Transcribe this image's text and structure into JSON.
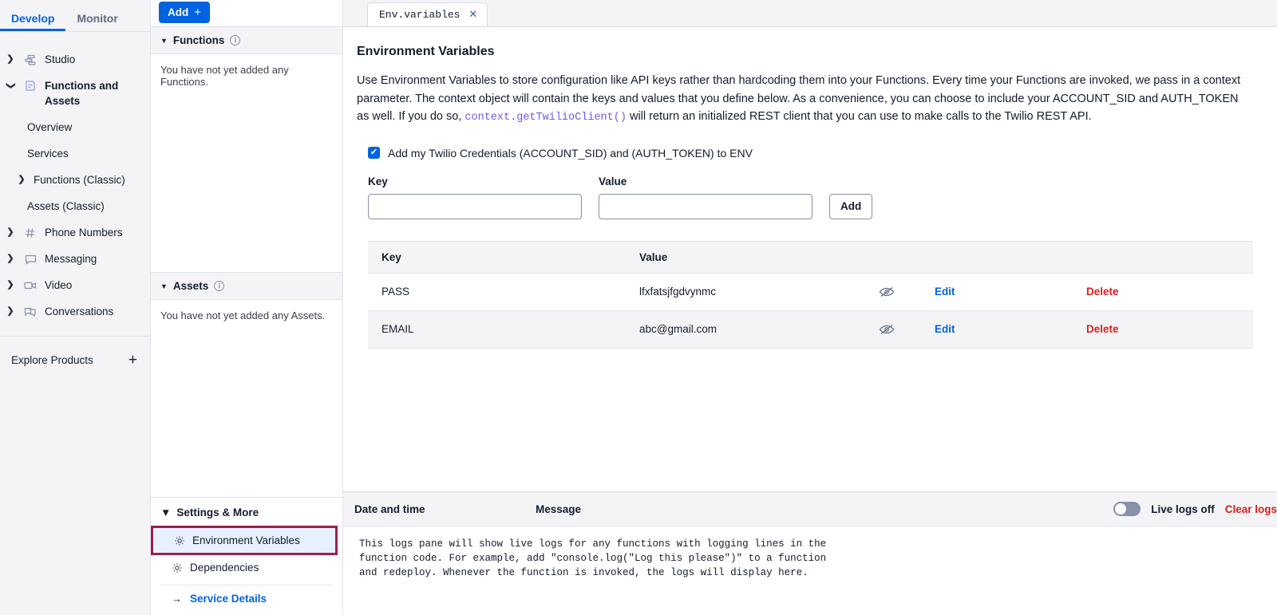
{
  "nav": {
    "tabs": [
      {
        "label": "Develop",
        "active": true
      },
      {
        "label": "Monitor",
        "active": false
      }
    ],
    "items": [
      {
        "label": "Studio",
        "icon": "studio-icon",
        "chevron": "right",
        "bold": false,
        "indent": 0
      },
      {
        "label": "Functions and Assets",
        "icon": "functions-icon",
        "chevron": "down",
        "bold": true,
        "indent": 0
      },
      {
        "label": "Overview",
        "icon": "",
        "chevron": "",
        "bold": false,
        "indent": 2
      },
      {
        "label": "Services",
        "icon": "",
        "chevron": "",
        "bold": false,
        "indent": 2
      },
      {
        "label": "Functions (Classic)",
        "icon": "",
        "chevron": "right",
        "bold": false,
        "indent": 1
      },
      {
        "label": "Assets (Classic)",
        "icon": "",
        "chevron": "",
        "bold": false,
        "indent": 2
      },
      {
        "label": "Phone Numbers",
        "icon": "hash-icon",
        "chevron": "right",
        "bold": false,
        "indent": 0
      },
      {
        "label": "Messaging",
        "icon": "chat-icon",
        "chevron": "right",
        "bold": false,
        "indent": 0
      },
      {
        "label": "Video",
        "icon": "video-icon",
        "chevron": "right",
        "bold": false,
        "indent": 0
      },
      {
        "label": "Conversations",
        "icon": "conversations-icon",
        "chevron": "right",
        "bold": false,
        "indent": 0
      }
    ],
    "explore_label": "Explore Products"
  },
  "midpanel": {
    "add_button": "Add",
    "functions_section": {
      "title": "Functions",
      "empty_text": "You have not yet added any Functions."
    },
    "assets_section": {
      "title": "Assets",
      "empty_text": "You have not yet added any Assets."
    },
    "settings_section": {
      "title": "Settings & More",
      "items": [
        {
          "label": "Environment Variables",
          "selected": true
        },
        {
          "label": "Dependencies",
          "selected": false
        }
      ],
      "service_details": "Service Details"
    }
  },
  "editor": {
    "tab": {
      "label": "Env.variables",
      "close": "✕"
    },
    "page_title": "Environment Variables",
    "description_part1": "Use Environment Variables to store configuration like API keys rather than hardcoding them into your Functions. Every time your Functions are invoked, we pass in a context parameter. The context object will contain the keys and values that you define below. As a convenience, you can choose to include your ACCOUNT_SID and AUTH_TOKEN as well. If you do so, ",
    "description_code": "context.getTwilioClient()",
    "description_part2": " will return an initialized REST client that you can use to make calls to the Twilio REST API.",
    "checkbox": {
      "checked": true,
      "label": "Add my Twilio Credentials (ACCOUNT_SID) and (AUTH_TOKEN) to ENV",
      "mark": "✔"
    },
    "form": {
      "key_label": "Key",
      "key_value": "",
      "key_placeholder": "",
      "value_label": "Value",
      "value_value": "",
      "value_placeholder": "",
      "add_label": "Add"
    },
    "table": {
      "headers": [
        "Key",
        "Value"
      ],
      "rows": [
        {
          "key": "PASS",
          "value": "lfxfatsjfgdvynmc",
          "edit": "Edit",
          "delete": "Delete",
          "eye": "eye-slash-icon"
        },
        {
          "key": "EMAIL",
          "value": "abc@gmail.com",
          "edit": "Edit",
          "delete": "Delete",
          "eye": "eye-slash-icon"
        }
      ]
    }
  },
  "logs": {
    "col_date": "Date and time",
    "col_message": "Message",
    "live_logs_label": "Live logs off",
    "live_logs_on": false,
    "clear_label": "Clear logs",
    "body": "This logs pane will show live logs for any functions with logging lines in the\nfunction code. For example, add \"console.log(\"Log this please\")\" to a function\nand redeploy. Whenever the function is invoked, the logs will display here."
  },
  "colors": {
    "accent_blue": "#0263e0",
    "danger_red": "#d61f1f",
    "highlight_border": "#9b2050",
    "code_purple": "#6b5ce7",
    "panel_grey": "#f4f4f6"
  }
}
